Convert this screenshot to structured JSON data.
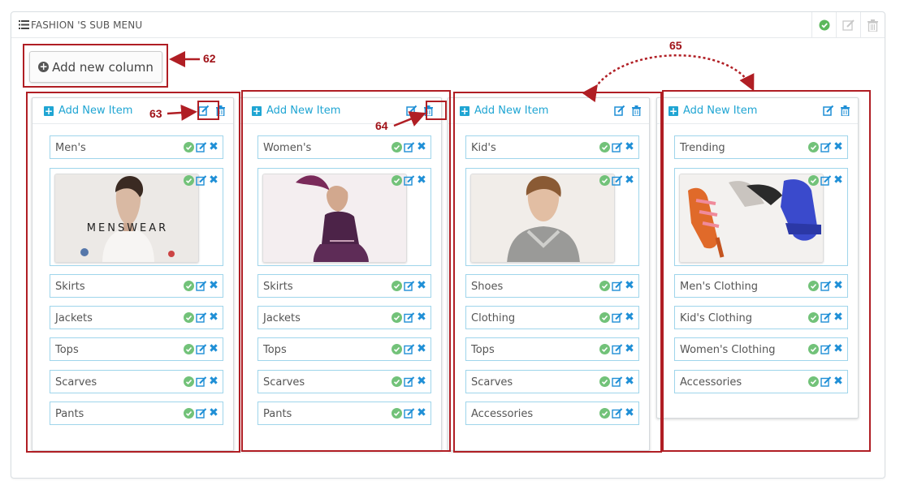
{
  "panel": {
    "title": "FASHION 'S SUB MENU",
    "icons": [
      "list-icon",
      "check-circle-icon",
      "edit-icon",
      "trash-icon"
    ]
  },
  "add_column_button": {
    "label": "Add new column",
    "icon": "plus-circle-icon"
  },
  "columns": [
    {
      "add_item_label": "Add New Item",
      "items": [
        "Men's",
        "Skirts",
        "Jackets",
        "Tops",
        "Scarves",
        "Pants"
      ],
      "image_caption": "MENSWEAR"
    },
    {
      "add_item_label": "Add New Item",
      "items": [
        "Women's",
        "Skirts",
        "Jackets",
        "Tops",
        "Scarves",
        "Pants"
      ],
      "image_caption": ""
    },
    {
      "add_item_label": "Add New Item",
      "items": [
        "Kid's",
        "Shoes",
        "Clothing",
        "Tops",
        "Scarves",
        "Accessories"
      ],
      "image_caption": ""
    },
    {
      "add_item_label": "Add New Item",
      "items": [
        "Trending",
        "Men's Clothing",
        "Kid's Clothing",
        "Women's Clothing",
        "Accessories"
      ],
      "image_caption": ""
    }
  ],
  "callouts": {
    "c62": "62",
    "c63": "63",
    "c64": "64",
    "c65": "65"
  },
  "colors": {
    "accent": "#1fa5d3",
    "ok": "#72c279",
    "callout": "#b01e24"
  }
}
